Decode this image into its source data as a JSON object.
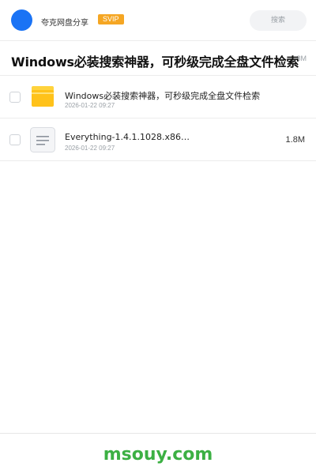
{
  "header": {
    "brand": "夸克网盘分享",
    "badge": "SVIP",
    "search_label": "搜索",
    "accent_color": "#1a73f5",
    "badge_color": "#f5a623"
  },
  "share": {
    "title": "Windows必装搜索神器，可秒级完成全盘文件检索",
    "meta": "1.8M"
  },
  "files": [
    {
      "icon": "folder-icon",
      "name": "Windows必装搜索神器，可秒级完成全盘文件检索",
      "date": "2026-01-22 09:27",
      "size": ""
    },
    {
      "icon": "document-icon",
      "name": "Everything-1.4.1.1028.x86…",
      "date": "2026-01-22 09:27",
      "size": "1.8M"
    }
  ],
  "footer": {
    "brand": "msouy.com",
    "brand_color": "#3cb043"
  }
}
